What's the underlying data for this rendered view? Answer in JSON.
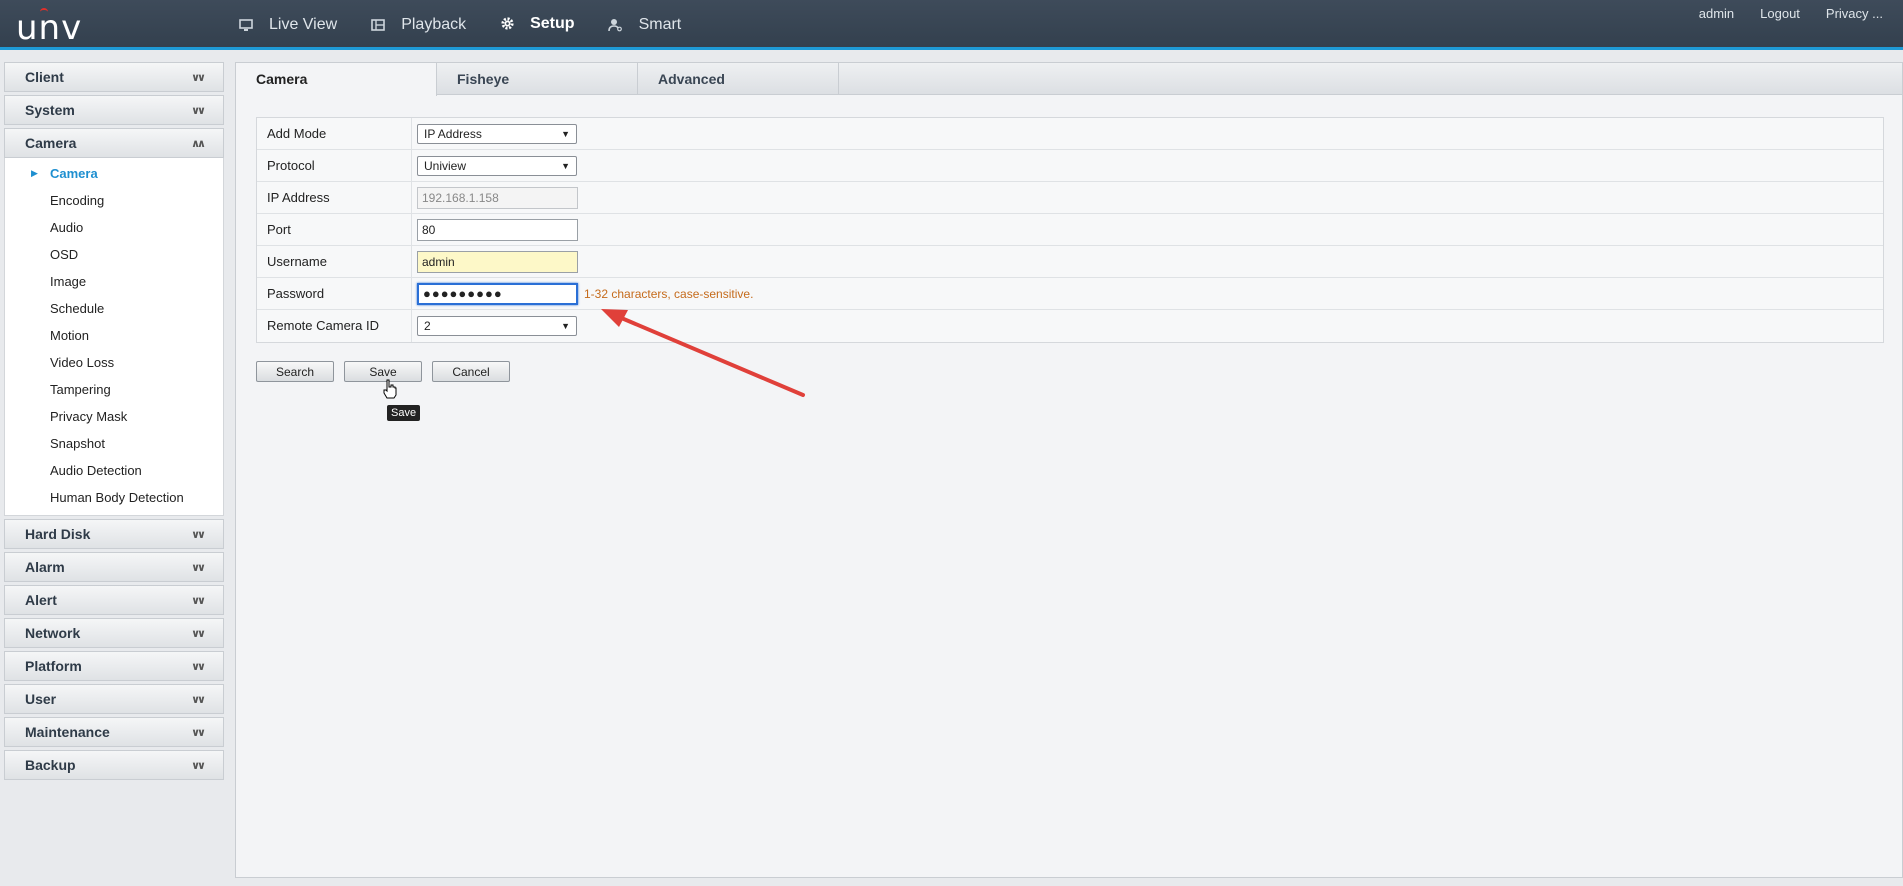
{
  "brand": {
    "logo": "unv",
    "accent": "#1e9ad6",
    "annotation_color": "#e0403a"
  },
  "topnav": [
    {
      "label": "Live View",
      "icon": "monitor-icon"
    },
    {
      "label": "Playback",
      "icon": "film-icon"
    },
    {
      "label": "Setup",
      "icon": "gear-icon",
      "active": true
    },
    {
      "label": "Smart",
      "icon": "person-search-icon"
    }
  ],
  "user": {
    "name": "admin",
    "logout": "Logout",
    "privacy": "Privacy ..."
  },
  "sidebar": {
    "groups_before": [
      {
        "label": "Client"
      },
      {
        "label": "System"
      }
    ],
    "camera_group": {
      "label": "Camera",
      "items": [
        "Camera",
        "Encoding",
        "Audio",
        "OSD",
        "Image",
        "Schedule",
        "Motion",
        "Video Loss",
        "Tampering",
        "Privacy Mask",
        "Snapshot",
        "Audio Detection",
        "Human Body Detection"
      ]
    },
    "groups_after": [
      {
        "label": "Hard Disk"
      },
      {
        "label": "Alarm"
      },
      {
        "label": "Alert"
      },
      {
        "label": "Network"
      },
      {
        "label": "Platform"
      },
      {
        "label": "User"
      },
      {
        "label": "Maintenance"
      },
      {
        "label": "Backup"
      }
    ]
  },
  "tabs": [
    "Camera",
    "Fisheye",
    "Advanced"
  ],
  "form": {
    "add_mode": {
      "label": "Add Mode",
      "value": "IP Address"
    },
    "protocol": {
      "label": "Protocol",
      "value": "Uniview"
    },
    "ip_address": {
      "label": "IP Address",
      "value": "192.168.1.158"
    },
    "port": {
      "label": "Port",
      "value": "80"
    },
    "username": {
      "label": "Username",
      "value": "admin"
    },
    "password": {
      "label": "Password",
      "value": "●●●●●●●●●",
      "hint": "1-32 characters, case-sensitive."
    },
    "remote_camera_id": {
      "label": "Remote Camera ID",
      "value": "2"
    }
  },
  "buttons": {
    "search": "Search",
    "save": "Save",
    "cancel": "Cancel"
  },
  "tooltip": "Save"
}
